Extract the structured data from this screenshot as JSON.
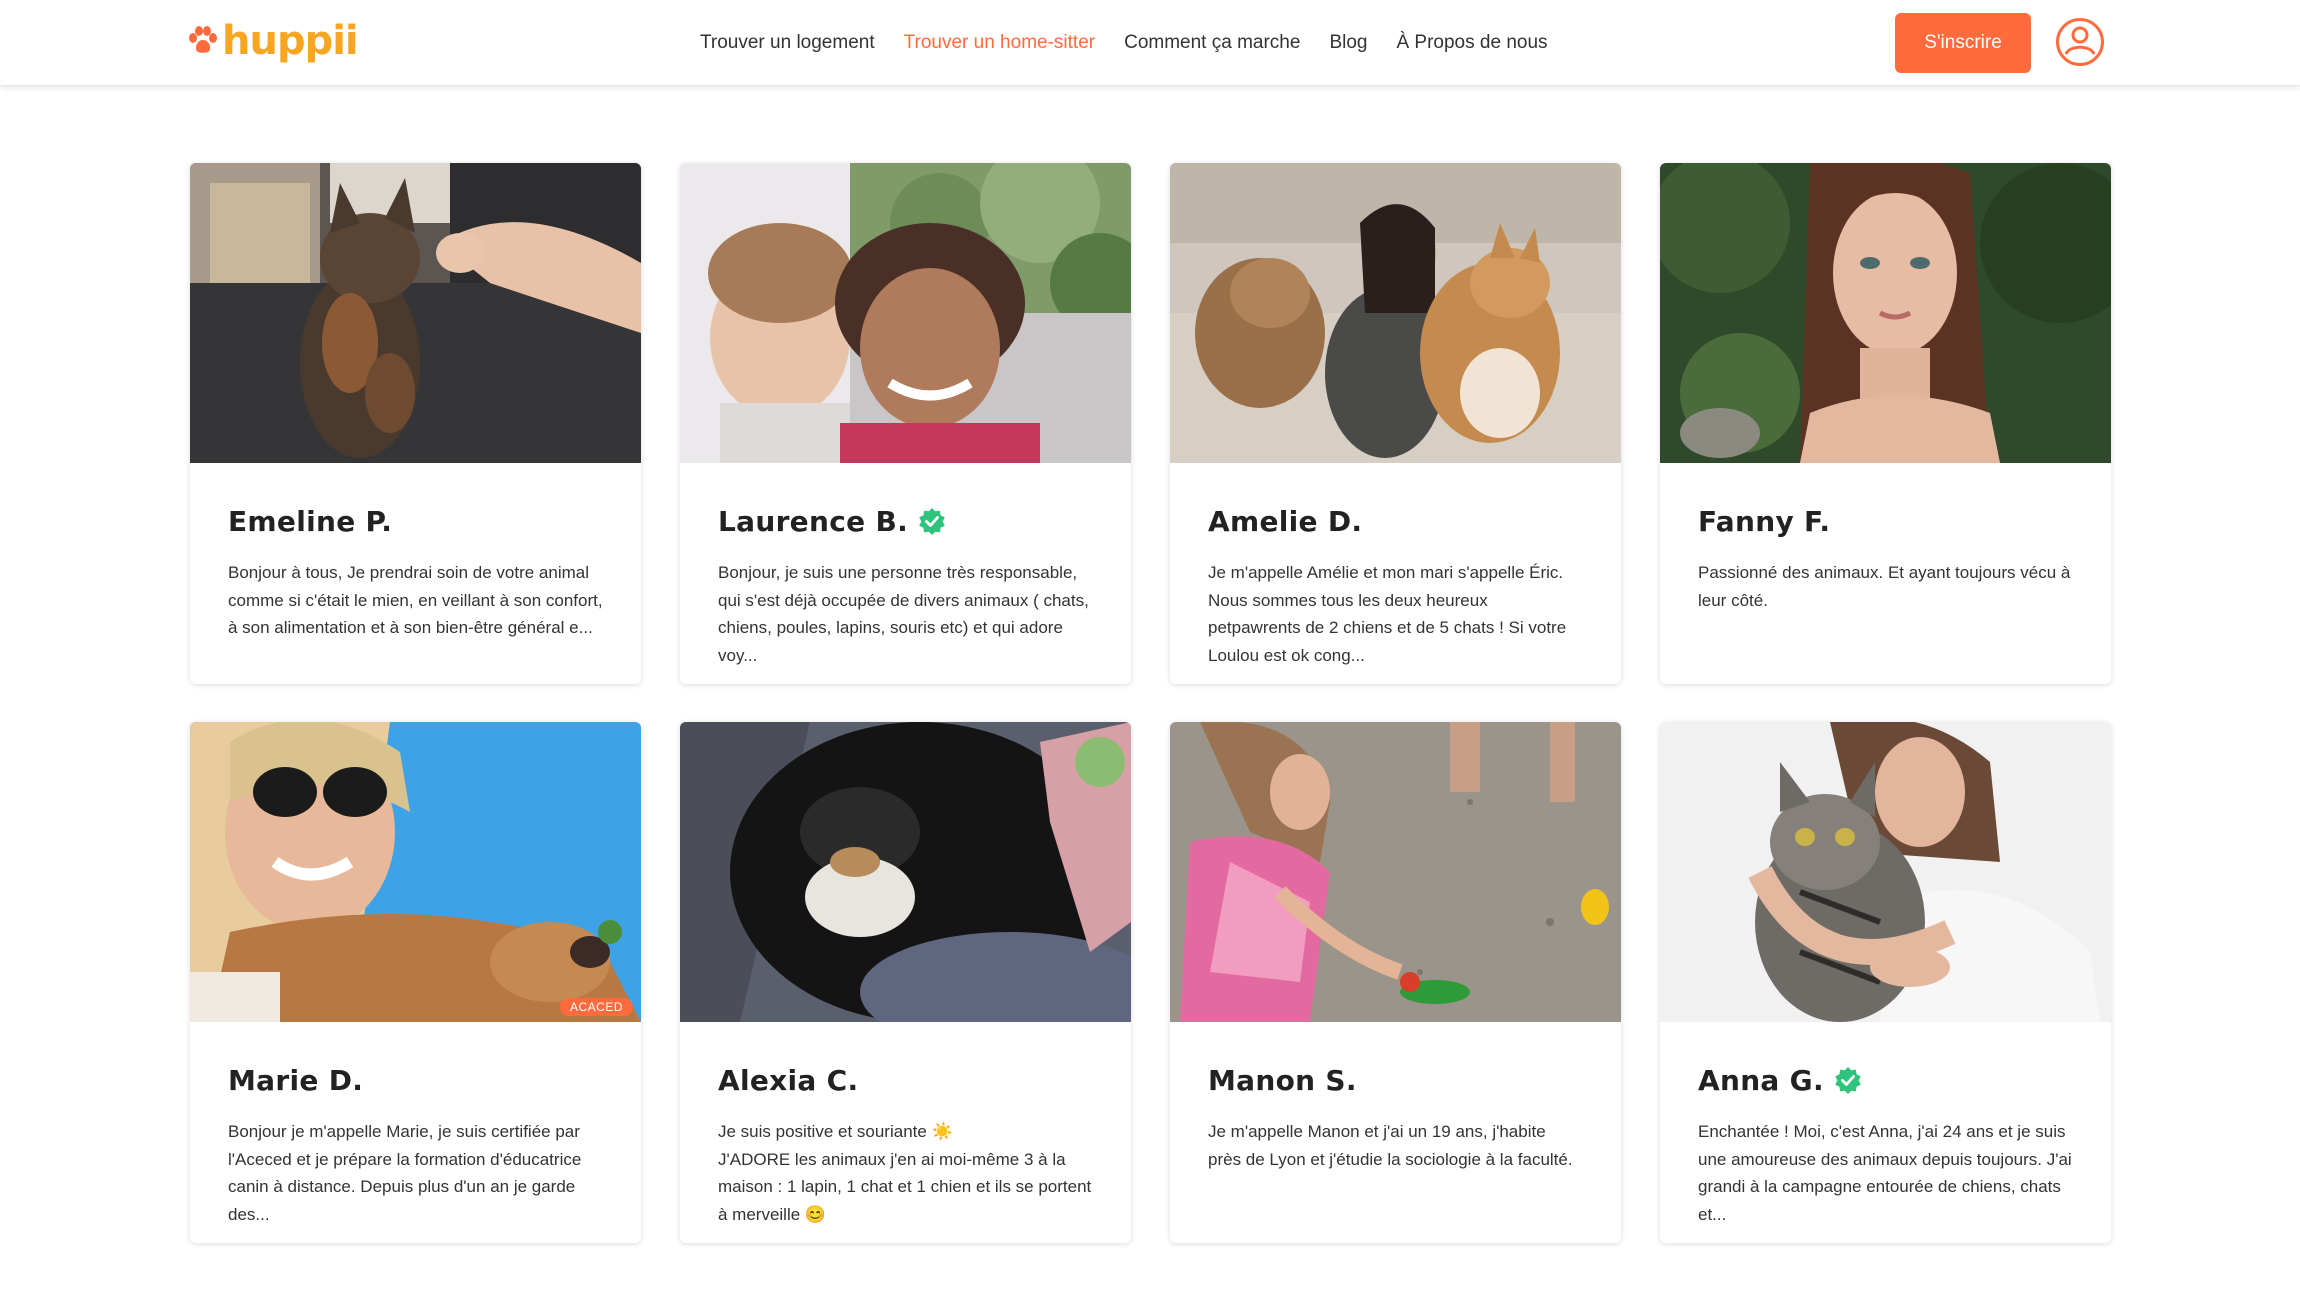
{
  "brand": {
    "name": "huppii",
    "color": "#f6a623",
    "icon": "paw-icon"
  },
  "nav": {
    "items": [
      {
        "label": "Trouver un logement",
        "active": false
      },
      {
        "label": "Trouver un home-sitter",
        "active": true
      },
      {
        "label": "Comment ça marche",
        "active": false
      },
      {
        "label": "Blog",
        "active": false
      },
      {
        "label": "À Propos de nous",
        "active": false
      }
    ]
  },
  "header": {
    "signup_label": "S'inscrire",
    "user_icon": "user-circle-icon"
  },
  "colors": {
    "accent": "#ff6b3d",
    "verified": "#2ec47c",
    "logo": "#f6a623"
  },
  "cards": [
    {
      "name": "Emeline P.",
      "verified": false,
      "photo": "cat-with-hand-photo",
      "description": "Bonjour à tous, Je prendrai soin de votre animal comme si c'était le mien, en veillant à son confort, à son alimentation et à son bien-être général e..."
    },
    {
      "name": "Laurence B.",
      "verified": true,
      "photo": "selfie-woman-child-photo",
      "description": "Bonjour, je suis une personne très responsable, qui s'est déjà occupée de divers animaux ( chats, chiens, poules, lapins, souris etc) et qui adore voy..."
    },
    {
      "name": "Amelie D.",
      "verified": false,
      "photo": "woman-with-dogs-sofa-photo",
      "description": "Je m'appelle Amélie et mon mari s'appelle Éric. Nous sommes tous les deux heureux petpawrents de 2 chiens et de 5 chats ! Si votre Loulou est ok cong..."
    },
    {
      "name": "Fanny F.",
      "verified": false,
      "photo": "portrait-woman-forest-photo",
      "description": "Passionné des animaux. Et ayant toujours vécu à leur côté."
    },
    {
      "name": "Marie D.",
      "verified": false,
      "photo": "selfie-woman-dog-sky-photo",
      "badge": "ACACED",
      "description": "Bonjour je m'appelle Marie, je suis certifiée par l'Aceced et je prépare la formation d'éducatrice canin à distance. Depuis plus d'un an je garde des..."
    },
    {
      "name": "Alexia C.",
      "verified": false,
      "photo": "sleeping-black-cat-photo",
      "description": "Je suis positive et souriante ☀️\nJ'ADORE les animaux j'en ai moi-même 3 à la maison : 1 lapin, 1 chat et 1 chien et ils se portent à merveille 😊"
    },
    {
      "name": "Manon S.",
      "verified": false,
      "photo": "woman-feeding-parrot-photo",
      "description": "Je m'appelle Manon et j'ai un 19 ans, j'habite près de Lyon et j'étudie la sociologie à la faculté."
    },
    {
      "name": "Anna G.",
      "verified": true,
      "photo": "woman-holding-tabby-cat-photo",
      "description": "Enchantée ! Moi, c'est Anna, j'ai 24 ans et je suis une amoureuse des animaux depuis toujours. J'ai grandi à la campagne entourée de chiens, chats et..."
    }
  ]
}
